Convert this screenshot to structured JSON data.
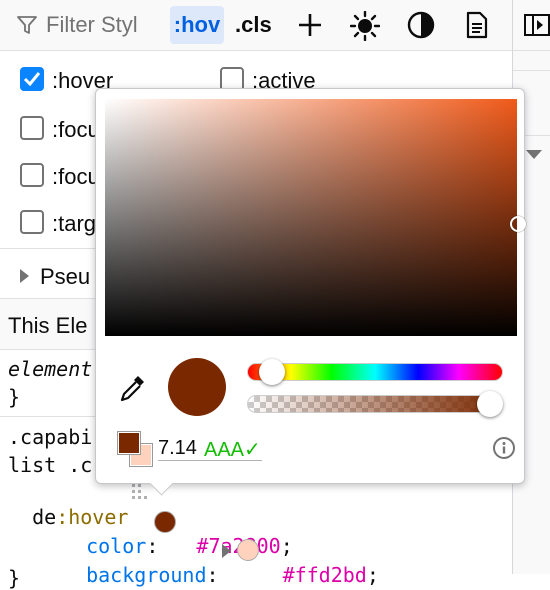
{
  "toolbar": {
    "filter_placeholder": "Filter Styl",
    "hov_label": ":hov",
    "cls_label": ".cls",
    "icons": [
      "filter-icon",
      "add-rule-icon",
      "light-theme-icon",
      "dark-theme-icon",
      "print-media-icon"
    ]
  },
  "pseudo_classes": [
    {
      "label": ":hover",
      "checked": true
    },
    {
      "label": ":active",
      "checked": false
    },
    {
      "label": ":focu",
      "checked": false
    },
    {
      "label": ":focu",
      "checked": false
    },
    {
      "label": ":targ",
      "checked": false
    }
  ],
  "sections": {
    "pseudo_elements": "Pseu",
    "this_element": "This Ele"
  },
  "code": {
    "element_line": "element",
    "element_close": "}",
    "sel1": ".capabi",
    "sel2": "list .c",
    "sel3_a": "de",
    "sel3_b": ":hover",
    "color_prop": "color",
    "color_value": "#7a2800",
    "bg_prop": "background",
    "bg_value": "#ffd2bd",
    "close": "}"
  },
  "picker": {
    "contrast_ratio": "7.14",
    "contrast_grade": "AAA✓",
    "hue_position": 0.05,
    "alpha": 1.0
  },
  "colors": {
    "current": "#7a2800",
    "background": "#ffd2bd",
    "accent": "#0a84ff",
    "hov_active": "#0060df",
    "prop": "#0074e8",
    "value": "#dd00a9"
  }
}
